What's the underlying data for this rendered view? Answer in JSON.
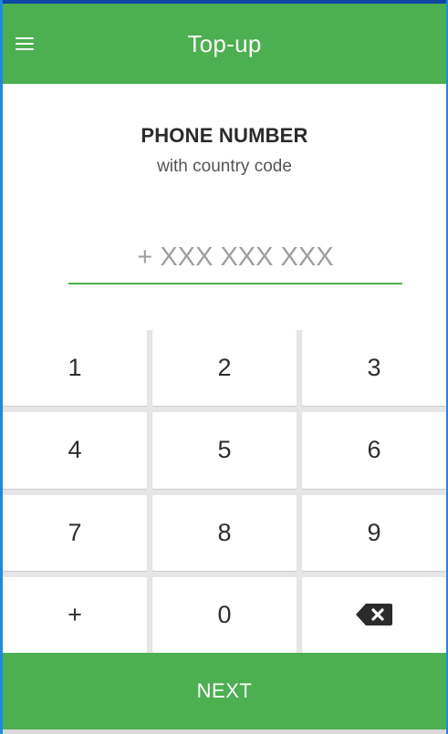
{
  "app": {
    "title": "Top-up",
    "accent_color": "#4caf50",
    "frame_color": "#1e88e5"
  },
  "header": {
    "menu_icon": "hamburger-menu-icon",
    "title": "PHONE NUMBER",
    "subtitle": "with country code"
  },
  "phone_input": {
    "value": "",
    "placeholder": "+ XXX XXX XXX"
  },
  "keypad": {
    "keys": [
      {
        "label": "1",
        "name": "key-1"
      },
      {
        "label": "2",
        "name": "key-2"
      },
      {
        "label": "3",
        "name": "key-3"
      },
      {
        "label": "4",
        "name": "key-4"
      },
      {
        "label": "5",
        "name": "key-5"
      },
      {
        "label": "6",
        "name": "key-6"
      },
      {
        "label": "7",
        "name": "key-7"
      },
      {
        "label": "8",
        "name": "key-8"
      },
      {
        "label": "9",
        "name": "key-9"
      },
      {
        "label": "+",
        "name": "key-plus"
      },
      {
        "label": "0",
        "name": "key-0"
      }
    ],
    "backspace_icon": "backspace-icon"
  },
  "footer": {
    "next_label": "NEXT"
  }
}
